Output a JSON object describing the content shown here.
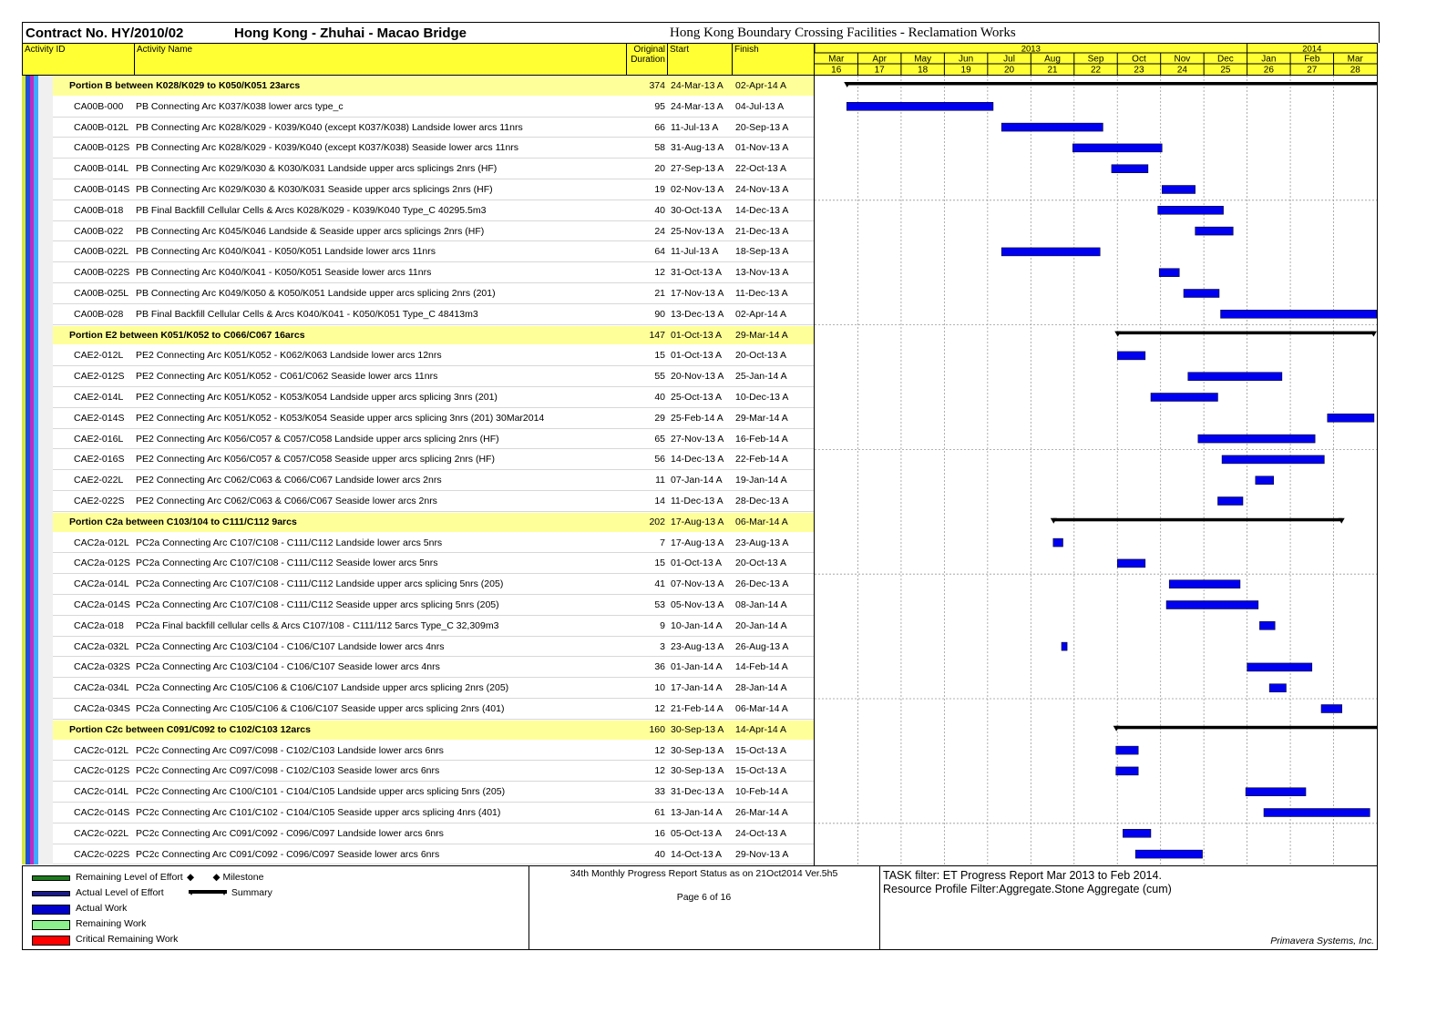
{
  "header": {
    "contract": "Contract No. HY/2010/02",
    "project": "Hong Kong - Zhuhai - Macao Bridge",
    "facility": "Hong Kong Boundary Crossing Facilities - Reclamation Works"
  },
  "columns": {
    "id": "Activity ID",
    "name": "Activity Name",
    "duration_1": "Original",
    "duration_2": "Duration",
    "start": "Start",
    "finish": "Finish"
  },
  "chart_data": {
    "type": "gantt",
    "years": [
      {
        "label": "2013",
        "months": 10
      },
      {
        "label": "2014",
        "months": 3
      }
    ],
    "months": [
      "Mar",
      "Apr",
      "May",
      "Jun",
      "Jul",
      "Aug",
      "Sep",
      "Oct",
      "Nov",
      "Dec",
      "Jan",
      "Feb",
      "Mar"
    ],
    "periods": [
      "16",
      "17",
      "18",
      "19",
      "20",
      "21",
      "22",
      "23",
      "24",
      "25",
      "26",
      "27",
      "28"
    ],
    "timeline_start": "2013-03-01",
    "timeline_end": "2014-03-31",
    "rows": [
      {
        "type": "group",
        "name": "Portion B between K028/K029 to K050/K051 23arcs",
        "duration": "374",
        "start": "24-Mar-13 A",
        "finish": "02-Apr-14 A",
        "s": "2013-03-24",
        "f": "2014-04-02"
      },
      {
        "type": "task",
        "id": "CA00B-000",
        "name": "PB Connecting Arc K037/K038 lower arcs type_c",
        "duration": "95",
        "start": "24-Mar-13 A",
        "finish": "04-Jul-13 A",
        "s": "2013-03-24",
        "f": "2013-07-04"
      },
      {
        "type": "task",
        "id": "CA00B-012L",
        "name": "PB Connecting Arc K028/K029 - K039/K040 (except K037/K038) Landside lower arcs 11nrs",
        "duration": "66",
        "start": "11-Jul-13 A",
        "finish": "20-Sep-13 A",
        "s": "2013-07-11",
        "f": "2013-09-20"
      },
      {
        "type": "task",
        "id": "CA00B-012S",
        "name": "PB Connecting Arc K028/K029 - K039/K040 (except K037/K038) Seaside lower arcs 11nrs",
        "duration": "58",
        "start": "31-Aug-13 A",
        "finish": "01-Nov-13 A",
        "s": "2013-08-31",
        "f": "2013-11-01"
      },
      {
        "type": "task",
        "id": "CA00B-014L",
        "name": "PB Connecting Arc K029/K030 & K030/K031 Landside upper arcs splicings 2nrs (HF)",
        "duration": "20",
        "start": "27-Sep-13 A",
        "finish": "22-Oct-13 A",
        "s": "2013-09-27",
        "f": "2013-10-22"
      },
      {
        "type": "task",
        "id": "CA00B-014S",
        "name": "PB Connecting Arc K029/K030 & K030/K031 Seaside upper arcs splicings 2nrs (HF)",
        "duration": "19",
        "start": "02-Nov-13 A",
        "finish": "24-Nov-13 A",
        "s": "2013-11-02",
        "f": "2013-11-24"
      },
      {
        "type": "task",
        "id": "CA00B-018",
        "name": "PB Final Backfill Cellular Cells & Arcs K028/K029 - K039/K040 Type_C 40295.5m3",
        "duration": "40",
        "start": "30-Oct-13 A",
        "finish": "14-Dec-13 A",
        "s": "2013-10-30",
        "f": "2013-12-14"
      },
      {
        "type": "task",
        "id": "CA00B-022",
        "name": "PB Connecting Arc K045/K046 Landside & Seaside upper arcs splicings 2nrs (HF)",
        "duration": "24",
        "start": "25-Nov-13 A",
        "finish": "21-Dec-13 A",
        "s": "2013-11-25",
        "f": "2013-12-21"
      },
      {
        "type": "task",
        "id": "CA00B-022L",
        "name": "PB Connecting Arc K040/K041 - K050/K051 Landside lower arcs 11nrs",
        "duration": "64",
        "start": "11-Jul-13 A",
        "finish": "18-Sep-13 A",
        "s": "2013-07-11",
        "f": "2013-09-18"
      },
      {
        "type": "task",
        "id": "CA00B-022S",
        "name": "PB Connecting Arc K040/K041 - K050/K051 Seaside lower arcs 11nrs",
        "duration": "12",
        "start": "31-Oct-13 A",
        "finish": "13-Nov-13 A",
        "s": "2013-10-31",
        "f": "2013-11-13"
      },
      {
        "type": "task",
        "id": "CA00B-025L",
        "name": "PB Connecting Arc K049/K050 & K050/K051 Landside upper arcs splicing 2nrs (201)",
        "duration": "21",
        "start": "17-Nov-13 A",
        "finish": "11-Dec-13 A",
        "s": "2013-11-17",
        "f": "2013-12-11"
      },
      {
        "type": "task",
        "id": "CA00B-028",
        "name": "PB Final Backfill Cellular Cells & Arcs K040/K041 - K050/K051 Type_C 48413m3",
        "duration": "90",
        "start": "13-Dec-13 A",
        "finish": "02-Apr-14 A",
        "s": "2013-12-13",
        "f": "2014-04-02"
      },
      {
        "type": "group",
        "name": "Portion E2 between K051/K052 to C066/C067 16arcs",
        "duration": "147",
        "start": "01-Oct-13 A",
        "finish": "29-Mar-14 A",
        "s": "2013-10-01",
        "f": "2014-03-29"
      },
      {
        "type": "task",
        "id": "CAE2-012L",
        "name": "PE2 Connecting Arc K051/K052 - K062/K063 Landside lower arcs 12nrs",
        "duration": "15",
        "start": "01-Oct-13 A",
        "finish": "20-Oct-13 A",
        "s": "2013-10-01",
        "f": "2013-10-20"
      },
      {
        "type": "task",
        "id": "CAE2-012S",
        "name": "PE2 Connecting Arc K051/K052 - C061/C062 Seaside lower arcs 11nrs",
        "duration": "55",
        "start": "20-Nov-13 A",
        "finish": "25-Jan-14 A",
        "s": "2013-11-20",
        "f": "2014-01-25"
      },
      {
        "type": "task",
        "id": "CAE2-014L",
        "name": "PE2 Connecting Arc K051/K052 - K053/K054 Landside upper arcs splicing 3nrs (201)",
        "duration": "40",
        "start": "25-Oct-13 A",
        "finish": "10-Dec-13 A",
        "s": "2013-10-25",
        "f": "2013-12-10"
      },
      {
        "type": "task",
        "id": "CAE2-014S",
        "name": "PE2 Connecting Arc K051/K052 - K053/K054 Seaside upper arcs splicing 3nrs (201) 30Mar2014",
        "duration": "29",
        "start": "25-Feb-14 A",
        "finish": "29-Mar-14 A",
        "s": "2014-02-25",
        "f": "2014-03-29"
      },
      {
        "type": "task",
        "id": "CAE2-016L",
        "name": "PE2 Connecting Arc K056/C057 & C057/C058 Landside upper arcs splicing 2nrs (HF)",
        "duration": "65",
        "start": "27-Nov-13 A",
        "finish": "16-Feb-14 A",
        "s": "2013-11-27",
        "f": "2014-02-16"
      },
      {
        "type": "task",
        "id": "CAE2-016S",
        "name": "PE2 Connecting Arc K056/C057 & C057/C058 Seaside upper arcs splicing 2nrs (HF)",
        "duration": "56",
        "start": "14-Dec-13 A",
        "finish": "22-Feb-14 A",
        "s": "2013-12-14",
        "f": "2014-02-22"
      },
      {
        "type": "task",
        "id": "CAE2-022L",
        "name": "PE2 Connecting Arc C062/C063 & C066/C067 Landside lower arcs 2nrs",
        "duration": "11",
        "start": "07-Jan-14 A",
        "finish": "19-Jan-14 A",
        "s": "2014-01-07",
        "f": "2014-01-19"
      },
      {
        "type": "task",
        "id": "CAE2-022S",
        "name": "PE2 Connecting Arc C062/C063 & C066/C067 Seaside lower arcs 2nrs",
        "duration": "14",
        "start": "11-Dec-13 A",
        "finish": "28-Dec-13 A",
        "s": "2013-12-11",
        "f": "2013-12-28"
      },
      {
        "type": "group",
        "name": "Portion C2a between C103/104 to C111/C112 9arcs",
        "duration": "202",
        "start": "17-Aug-13 A",
        "finish": "06-Mar-14 A",
        "s": "2013-08-17",
        "f": "2014-03-06"
      },
      {
        "type": "task",
        "id": "CAC2a-012L",
        "name": "PC2a Connecting Arc C107/C108 - C111/C112 Landside lower arcs 5nrs",
        "duration": "7",
        "start": "17-Aug-13 A",
        "finish": "23-Aug-13 A",
        "s": "2013-08-17",
        "f": "2013-08-23"
      },
      {
        "type": "task",
        "id": "CAC2a-012S",
        "name": "PC2a Connecting Arc C107/C108 - C111/C112 Seaside lower arcs 5nrs",
        "duration": "15",
        "start": "01-Oct-13 A",
        "finish": "20-Oct-13 A",
        "s": "2013-10-01",
        "f": "2013-10-20"
      },
      {
        "type": "task",
        "id": "CAC2a-014L",
        "name": "PC2a Connecting Arc C107/C108 - C111/C112 Landside upper arcs splicing 5nrs (205)",
        "duration": "41",
        "start": "07-Nov-13 A",
        "finish": "26-Dec-13 A",
        "s": "2013-11-07",
        "f": "2013-12-26"
      },
      {
        "type": "task",
        "id": "CAC2a-014S",
        "name": "PC2a Connecting Arc C107/C108 - C111/C112 Seaside upper arcs splicing 5nrs (205)",
        "duration": "53",
        "start": "05-Nov-13 A",
        "finish": "08-Jan-14 A",
        "s": "2013-11-05",
        "f": "2014-01-08"
      },
      {
        "type": "task",
        "id": "CAC2a-018",
        "name": "PC2a Final backfill cellular cells & Arcs C107/108 - C111/112 5arcs Type_C 32,309m3",
        "duration": "9",
        "start": "10-Jan-14 A",
        "finish": "20-Jan-14 A",
        "s": "2014-01-10",
        "f": "2014-01-20"
      },
      {
        "type": "task",
        "id": "CAC2a-032L",
        "name": "PC2a Connecting Arc C103/C104 - C106/C107 Landside lower arcs 4nrs",
        "duration": "3",
        "start": "23-Aug-13 A",
        "finish": "26-Aug-13 A",
        "s": "2013-08-23",
        "f": "2013-08-26"
      },
      {
        "type": "task",
        "id": "CAC2a-032S",
        "name": "PC2a Connecting Arc C103/C104 - C106/C107 Seaside lower arcs 4nrs",
        "duration": "36",
        "start": "01-Jan-14 A",
        "finish": "14-Feb-14 A",
        "s": "2014-01-01",
        "f": "2014-02-14"
      },
      {
        "type": "task",
        "id": "CAC2a-034L",
        "name": "PC2a Connecting Arc C105/C106 & C106/C107 Landside upper arcs splicing 2nrs (205)",
        "duration": "10",
        "start": "17-Jan-14 A",
        "finish": "28-Jan-14 A",
        "s": "2014-01-17",
        "f": "2014-01-28"
      },
      {
        "type": "task",
        "id": "CAC2a-034S",
        "name": "PC2a Connecting Arc C105/C106 & C106/C107 Seaside upper arcs splicing 2nrs (401)",
        "duration": "12",
        "start": "21-Feb-14 A",
        "finish": "06-Mar-14 A",
        "s": "2014-02-21",
        "f": "2014-03-06"
      },
      {
        "type": "group",
        "name": "Portion C2c between C091/C092 to C102/C103 12arcs",
        "duration": "160",
        "start": "30-Sep-13 A",
        "finish": "14-Apr-14 A",
        "s": "2013-09-30",
        "f": "2014-04-14"
      },
      {
        "type": "task",
        "id": "CAC2c-012L",
        "name": "PC2c Connecting Arc C097/C098 - C102/C103 Landside lower arcs 6nrs",
        "duration": "12",
        "start": "30-Sep-13 A",
        "finish": "15-Oct-13 A",
        "s": "2013-09-30",
        "f": "2013-10-15"
      },
      {
        "type": "task",
        "id": "CAC2c-012S",
        "name": "PC2c Connecting Arc C097/C098 - C102/C103 Seaside lower arcs 6nrs",
        "duration": "12",
        "start": "30-Sep-13 A",
        "finish": "15-Oct-13 A",
        "s": "2013-09-30",
        "f": "2013-10-15"
      },
      {
        "type": "task",
        "id": "CAC2c-014L",
        "name": "PC2c Connecting Arc C100/C101 - C104/C105 Landside upper arcs splicing 5nrs (205)",
        "duration": "33",
        "start": "31-Dec-13 A",
        "finish": "10-Feb-14 A",
        "s": "2013-12-31",
        "f": "2014-02-10"
      },
      {
        "type": "task",
        "id": "CAC2c-014S",
        "name": "PC2c Connecting Arc C101/C102 - C104/C105 Seaside upper arcs splicing 4nrs (401)",
        "duration": "61",
        "start": "13-Jan-14 A",
        "finish": "26-Mar-14 A",
        "s": "2014-01-13",
        "f": "2014-03-26"
      },
      {
        "type": "task",
        "id": "CAC2c-022L",
        "name": "PC2c Connecting Arc C091/C092 - C096/C097 Landside lower arcs 6nrs",
        "duration": "16",
        "start": "05-Oct-13 A",
        "finish": "24-Oct-13 A",
        "s": "2013-10-05",
        "f": "2013-10-24"
      },
      {
        "type": "task",
        "id": "CAC2c-022S",
        "name": "PC2c Connecting Arc C091/C092 - C096/C097 Seaside lower arcs 6nrs",
        "duration": "40",
        "start": "14-Oct-13 A",
        "finish": "29-Nov-13 A",
        "s": "2013-10-14",
        "f": "2013-11-29"
      }
    ]
  },
  "legend": {
    "items": [
      {
        "label": "Remaining Level of Effort",
        "color": "#1f7a1f"
      },
      {
        "label": "Actual Level of Effort",
        "color": "#1a1a8c"
      },
      {
        "label": "Actual Work",
        "color": "#0000cc"
      },
      {
        "label": "Remaining Work",
        "color": "#8cf08c"
      },
      {
        "label": "Critical Remaining Work",
        "color": "#ff0000"
      }
    ],
    "milestone": "Milestone",
    "summary": "Summary"
  },
  "footer": {
    "report": "34th Monthly Progress Report Status as on 21Oct2014 Ver.5h5",
    "page": "Page 6 of 16",
    "task_filter": "TASK filter: ET Progress Report Mar 2013 to Feb 2014.",
    "resource_filter": "Resource Profile Filter:Aggregate.Stone Aggregate (cum)",
    "vendor": "Primavera Systems, Inc."
  },
  "colors": {
    "header_yellow": "#ffff33",
    "group_yellow": "#ffff99",
    "bar_blue": "#0000ee",
    "summary_black": "#000000",
    "stripes": [
      "#d4e63c",
      "#1f4fd6",
      "#c02cc0",
      "#3fa9ff",
      "#f0f0f0"
    ]
  }
}
